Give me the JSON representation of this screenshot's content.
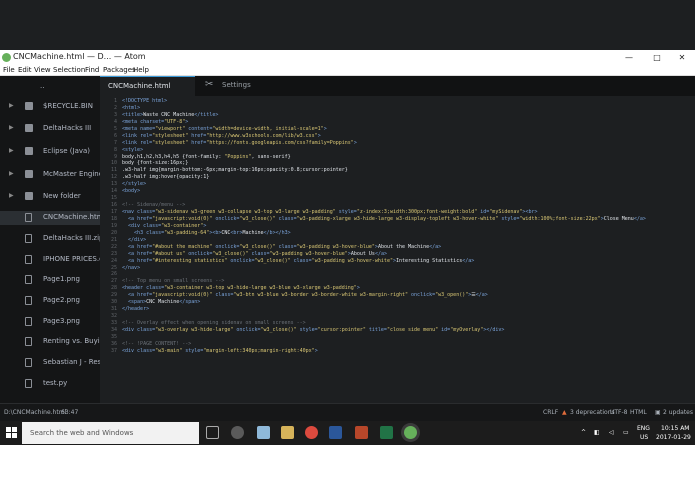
{
  "window": {
    "title": "CNCMachine.html — D... — Atom",
    "controls": [
      "—",
      "□",
      "✕"
    ]
  },
  "menu": [
    "File",
    "Edit",
    "View",
    "Selection",
    "Find",
    "Packages",
    "Help"
  ],
  "tree": [
    {
      "label": "..",
      "type": "folder"
    },
    {
      "label": "$RECYCLE.BIN",
      "type": "folder"
    },
    {
      "label": "DeltaHacks III",
      "type": "folder"
    },
    {
      "label": "Eclipse (Java)",
      "type": "folder"
    },
    {
      "label": "McMaster Enginee",
      "type": "folder"
    },
    {
      "label": "New folder",
      "type": "folder"
    },
    {
      "label": "CNCMachine.html",
      "type": "file",
      "selected": true
    },
    {
      "label": "DeltaHacks III.zip",
      "type": "file"
    },
    {
      "label": "IPHONE PRICES.do",
      "type": "file"
    },
    {
      "label": "Page1.png",
      "type": "file"
    },
    {
      "label": "Page2.png",
      "type": "file"
    },
    {
      "label": "Page3.png",
      "type": "file"
    },
    {
      "label": "Renting vs. Buying",
      "type": "file"
    },
    {
      "label": "Sebastian J - Resu",
      "type": "file"
    },
    {
      "label": "test.py",
      "type": "file"
    }
  ],
  "tabs": {
    "file": "CNCMachine.html",
    "settings": "Settings"
  },
  "code_lines": [
    "<!DOCTYPE html>",
    "<html>",
    "<title>Waste CNC Machine</title>",
    "<meta charset=\"UTF-8\">",
    "<meta name=\"viewport\" content=\"width=device-width, initial-scale=1\">",
    "<link rel=\"stylesheet\" href=\"http://www.w3schools.com/lib/w3.css\">",
    "<link rel=\"stylesheet\" href=\"https://fonts.googleapis.com/css?family=Poppins\">",
    "<style>",
    "body,h1,h2,h3,h4,h5 {font-family: \"Poppins\", sans-serif}",
    "body {font-size:16px;}",
    ".w3-half img{margin-bottom:-6px;margin-top:16px;opacity:0.8;cursor:pointer}",
    ".w3-half img:hover{opacity:1}",
    "</style>",
    "<body>",
    "",
    "<!-- Sidenav/menu -->",
    "<nav class=\"w3-sidenav w3-green w3-collapse w3-top w3-large w3-padding\" style=\"z-index:3;width:300px;font-weight:bold\" id=\"mySidenav\"><br>",
    "  <a href=\"javascript:void(0)\" onclick=\"w3_close()\" class=\"w3-padding-xlarge w3-hide-large w3-display-topleft w3-hover-white\" style=\"width:100%;font-size:22px\">Close Menu</a>",
    "  <div class=\"w3-container\">",
    "    <h3 class=\"w3-padding-64\"><b>CNC<br>Machine</b></h3>",
    "  </div>",
    "  <a href=\"#about the machine\" onclick=\"w3_close()\" class=\"w3-padding w3-hover-blue\">About the Machine</a>",
    "  <a href=\"#about us\" onclick=\"w3_close()\" class=\"w3-padding w3-hover-blue\">About Us</a>",
    "  <a href=\"#interesting statistics\" onclick=\"w3_close()\" class=\"w3-padding w3-hover-white\">Interesting Statistics</a>",
    "</nav>",
    "",
    "<!-- Top menu on small screens -->",
    "<header class=\"w3-container w3-top w3-hide-large w3-blue w3-xlarge w3-padding\">",
    "  <a href=\"javascript:void(0)\" class=\"w3-btn w3-blue w3-border w3-border-white w3-margin-right\" onclick=\"w3_open()\">☰</a>",
    "  <span>CNC Machine</span>",
    "</header>",
    "",
    "<!-- Overlay effect when opening sidenav on small screens -->",
    "<div class=\"w3-overlay w3-hide-large\" onclick=\"w3_close()\" style=\"cursor:pointer\" title=\"close side menu\" id=\"myOverlay\"></div>",
    "",
    "<!-- !PAGE CONTENT! -->",
    "<div class=\"w3-main\" style=\"margin-left:340px;margin-right:40px\">"
  ],
  "status": {
    "path": "D:\\CNCMachine.html",
    "cursor": "63:47",
    "line_ending": "CRLF",
    "deprecations": "3 deprecations",
    "encoding": "UTF-8",
    "grammar": "HTML",
    "updates": "2 updates"
  },
  "taskbar": {
    "search_placeholder": "Search the web and Windows",
    "language": "ENG",
    "region": "US",
    "time": "10:15 AM",
    "date": "2017-01-29"
  },
  "colors": {
    "accent": "#3a9ad9",
    "tag": "#7aa3d9",
    "string": "#d8c674",
    "comment": "#6b7178",
    "warning": "#e06c3b"
  }
}
